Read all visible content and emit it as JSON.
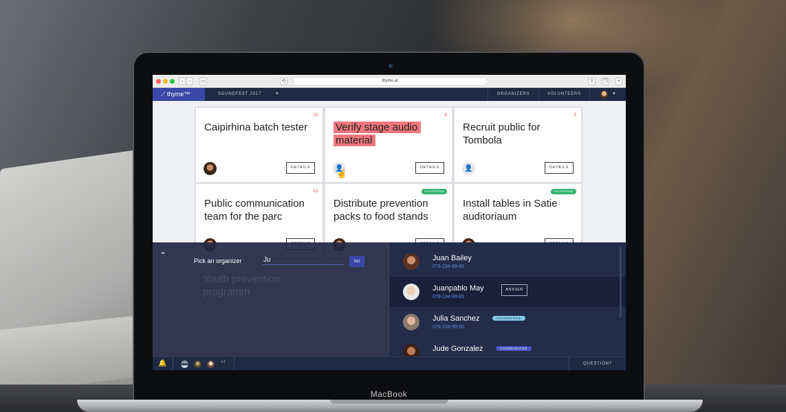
{
  "browser": {
    "url": "thyme.at"
  },
  "header": {
    "logo": "thyme™",
    "event": "SOUNDFEST 2017",
    "nav": [
      "ORGANIZERS",
      "VOLUNTEERS"
    ]
  },
  "cards": [
    {
      "title": "Caipirhina batch tester",
      "count": "13",
      "details": "DETAILS"
    },
    {
      "title": "Verify stage audio material",
      "count": "8",
      "details": "DETAILS"
    },
    {
      "title": "Recruit public for Tombola",
      "count": "5",
      "details": "DETAILS"
    },
    {
      "title": "Public communication team for the parc",
      "count": "13",
      "details": "DETAILS"
    },
    {
      "title": "Distribute prevention packs to food stands",
      "badge": "VALIDATED",
      "details": "DETAILS"
    },
    {
      "title": "Install tables in Satie auditoriaum",
      "badge": "VALIDATED",
      "details": "DETAILS"
    }
  ],
  "ghost_card": {
    "title": "Youth prevention programm"
  },
  "picker": {
    "label": "Pick an organizer",
    "query": "Ju",
    "go": "GO"
  },
  "people": [
    {
      "name": "Juan Bailey",
      "phone": "079-234-99-65"
    },
    {
      "name": "Juanpablo May",
      "phone": "079-234-99-65",
      "assign": "ASSIGN"
    },
    {
      "name": "Julia Sanchez",
      "phone": "079-234-99-65",
      "tag": "ACCOUSTICS",
      "tag_color": "#7ec8e8"
    },
    {
      "name": "Jude Gonzalez",
      "tag": "COORDINATOR",
      "tag_color": "#4a55c9"
    }
  ],
  "footer": {
    "more": "+7",
    "question": "QUESTION?"
  },
  "laptop": {
    "brand": "MacBook"
  },
  "colors": {
    "accent": "#3b47a6",
    "header": "#1f2a44",
    "highlight": "#f0787e",
    "validated": "#2fb36a"
  }
}
